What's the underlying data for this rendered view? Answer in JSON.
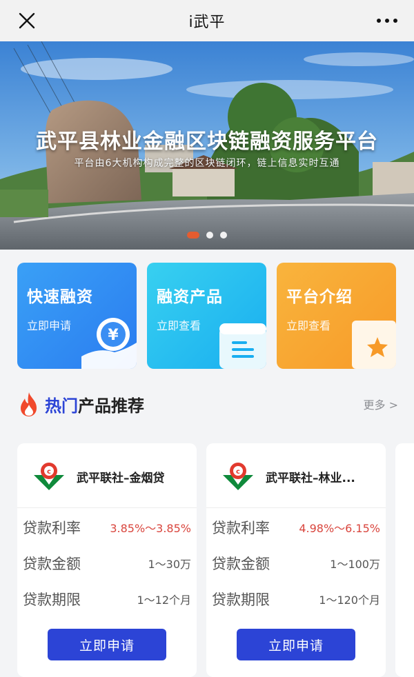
{
  "topbar": {
    "title": "i武平",
    "close_icon": "close-icon",
    "more_icon": "more-dots-icon"
  },
  "banner": {
    "headline": "武平县林业金融区块链融资服务平台",
    "subline": "平台由6大机构构成完整的区块链闭环，链上信息实时互通",
    "slide_count": 3,
    "active_slide": 1,
    "accent_color": "#f25a28"
  },
  "tiles": [
    {
      "title": "快速融资",
      "sub": "立即申请",
      "icon": "yuan-hand-icon",
      "color": "#2a7cf0"
    },
    {
      "title": "融资产品",
      "sub": "立即查看",
      "icon": "document-icon",
      "color": "#19aef0"
    },
    {
      "title": "平台介绍",
      "sub": "立即查看",
      "icon": "star-book-icon",
      "color": "#f79a28"
    }
  ],
  "section": {
    "title_highlight": "热门",
    "title_rest": "产品推荐",
    "more": "更多 >",
    "icon": "flame-icon",
    "highlight_color": "#2c44d6"
  },
  "cards": [
    {
      "name": "武平联社–金烟贷",
      "logo": "rural-credit-logo-icon",
      "rows": [
        {
          "label": "贷款利率",
          "value": "3.85%～3.85%"
        },
        {
          "label": "贷款金额",
          "value": "1～30万"
        },
        {
          "label": "贷款期限",
          "value": "1～12个月"
        }
      ],
      "apply": "立即申请"
    },
    {
      "name": "武平联社–林业...",
      "logo": "rural-credit-logo-icon",
      "rows": [
        {
          "label": "贷款利率",
          "value": "4.98%～6.15%"
        },
        {
          "label": "贷款金额",
          "value": "1～100万"
        },
        {
          "label": "贷款期限",
          "value": "1～120个月"
        }
      ],
      "apply": "立即申请"
    }
  ]
}
